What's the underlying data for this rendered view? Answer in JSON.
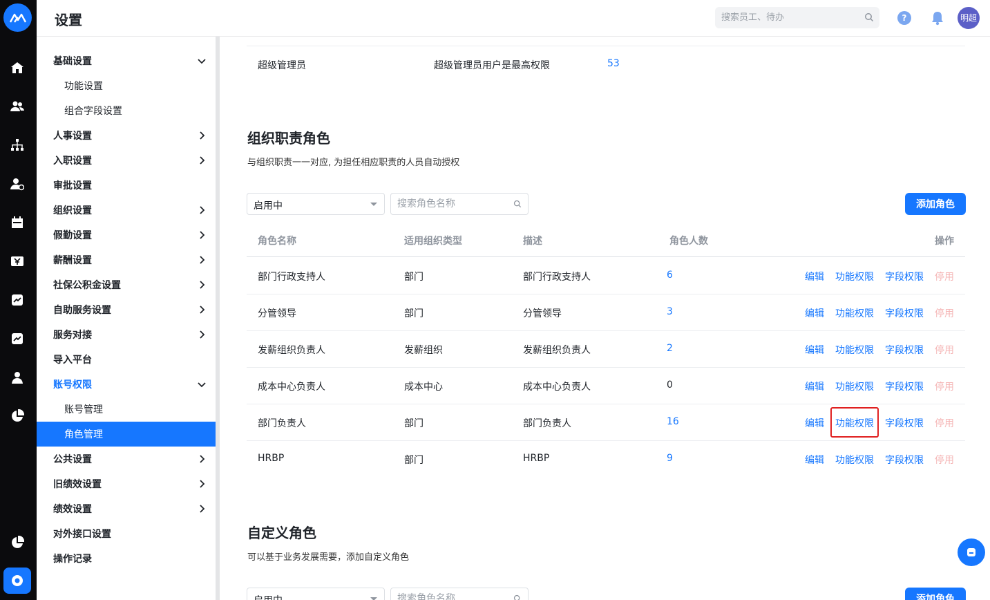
{
  "header": {
    "title": "设置",
    "search_placeholder": "搜索员工、待办",
    "help_label": "?",
    "avatar_text": "明超"
  },
  "sidebar": {
    "items": [
      {
        "label": "基础设置"
      },
      {
        "label": "功能设置"
      },
      {
        "label": "组合字段设置"
      },
      {
        "label": "人事设置"
      },
      {
        "label": "入职设置"
      },
      {
        "label": "审批设置"
      },
      {
        "label": "组织设置"
      },
      {
        "label": "假勤设置"
      },
      {
        "label": "薪酬设置"
      },
      {
        "label": "社保公积金设置"
      },
      {
        "label": "自助服务设置"
      },
      {
        "label": "服务对接"
      },
      {
        "label": "导入平台"
      },
      {
        "label": "账号权限"
      },
      {
        "label": "账号管理"
      },
      {
        "label": "角色管理"
      },
      {
        "label": "公共设置"
      },
      {
        "label": "旧绩效设置"
      },
      {
        "label": "绩效设置"
      },
      {
        "label": "对外接口设置"
      },
      {
        "label": "操作记录"
      }
    ]
  },
  "super_admin_row": {
    "name": "超级管理员",
    "desc": "超级管理员用户是最高权限",
    "count": "53"
  },
  "org_section": {
    "title": "组织职责角色",
    "description": "与组织职责一一对应, 为担任相应职责的人员自动授权",
    "status_select": "启用中",
    "search_placeholder": "搜索角色名称",
    "add_button": "添加角色",
    "columns": [
      "角色名称",
      "适用组织类型",
      "描述",
      "角色人数",
      "操作"
    ],
    "rows": [
      {
        "name": "部门行政支持人",
        "org_type": "部门",
        "desc": "部门行政支持人",
        "count": "6"
      },
      {
        "name": "分管领导",
        "org_type": "部门",
        "desc": "分管领导",
        "count": "3"
      },
      {
        "name": "发薪组织负责人",
        "org_type": "发薪组织",
        "desc": "发薪组织负责人",
        "count": "2"
      },
      {
        "name": "成本中心负责人",
        "org_type": "成本中心",
        "desc": "成本中心负责人",
        "count": "0"
      },
      {
        "name": "部门负责人",
        "org_type": "部门",
        "desc": "部门负责人",
        "count": "16"
      },
      {
        "name": "HRBP",
        "org_type": "部门",
        "desc": "HRBP",
        "count": "9"
      }
    ],
    "actions": {
      "edit": "编辑",
      "func_perm": "功能权限",
      "field_perm": "字段权限",
      "disable": "停用"
    }
  },
  "custom_section": {
    "title": "自定义角色",
    "description": "可以基于业务发展需要，添加自定义角色",
    "status_select": "启用中",
    "search_placeholder": "搜索角色名称",
    "add_button": "添加角色"
  },
  "colors": {
    "accent": "#1677ff",
    "rail": "#0b0b0d",
    "highlight": "#e02020",
    "disabled": "#f5b5b5"
  }
}
